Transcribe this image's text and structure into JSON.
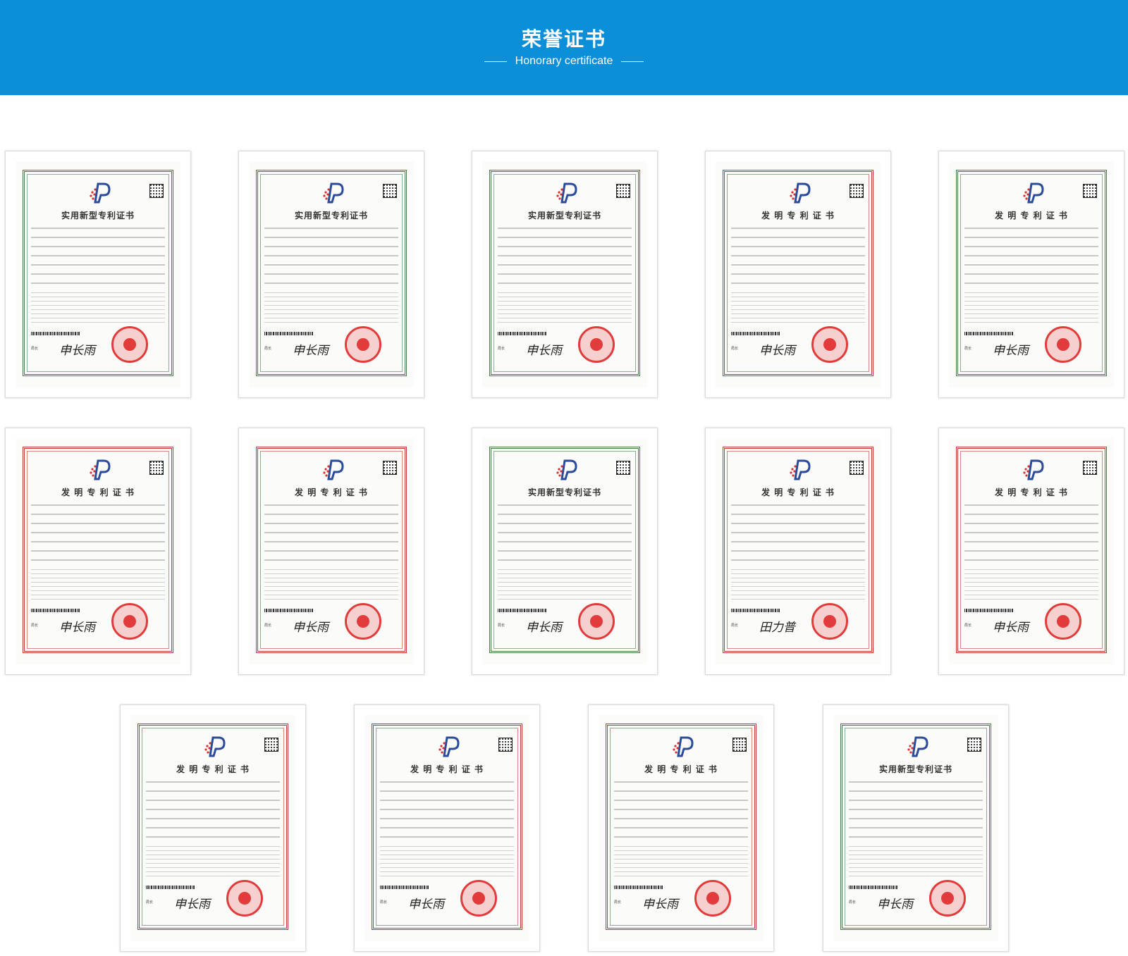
{
  "header": {
    "title": "荣誉证书",
    "subtitle": "Honorary certificate"
  },
  "colors": {
    "banner": "#0b8fd9",
    "frame_green": "#4a7a4a",
    "frame_red": "#c63b3b",
    "seal_red": "#e23b3b"
  },
  "certificates": [
    {
      "title": "实用新型专利证书",
      "frame": "green",
      "sig_label": "局长",
      "signature": "申长雨"
    },
    {
      "title": "实用新型专利证书",
      "frame": "green",
      "sig_label": "局长",
      "signature": "申长雨"
    },
    {
      "title": "实用新型专利证书",
      "frame": "green",
      "sig_label": "局长",
      "signature": "申长雨"
    },
    {
      "title": "发 明 专 利 证 书",
      "frame": "red",
      "sig_label": "局长",
      "signature": "申长雨"
    },
    {
      "title": "发 明 专 利 证 书",
      "frame": "green",
      "sig_label": "局长",
      "signature": "申长雨"
    },
    {
      "title": "发 明 专 利 证 书",
      "frame": "red",
      "sig_label": "局长",
      "signature": "申长雨"
    },
    {
      "title": "发 明 专 利 证 书",
      "frame": "red",
      "sig_label": "局长",
      "signature": "申长雨"
    },
    {
      "title": "实用新型专利证书",
      "frame": "green",
      "sig_label": "局长",
      "signature": "申长雨"
    },
    {
      "title": "发 明 专 利 证 书",
      "frame": "red",
      "sig_label": "局长",
      "signature": "田力普"
    },
    {
      "title": "发 明 专 利 证 书",
      "frame": "red",
      "sig_label": "局长",
      "signature": "申长雨"
    },
    {
      "title": "发 明 专 利 证 书",
      "frame": "red",
      "sig_label": "局长",
      "signature": "申长雨"
    },
    {
      "title": "发 明 专 利 证 书",
      "frame": "red",
      "sig_label": "局长",
      "signature": "申长雨"
    },
    {
      "title": "发 明 专 利 证 书",
      "frame": "red",
      "sig_label": "局长",
      "signature": "申长雨"
    },
    {
      "title": "实用新型专利证书",
      "frame": "green",
      "sig_label": "局长",
      "signature": "申长雨"
    }
  ]
}
